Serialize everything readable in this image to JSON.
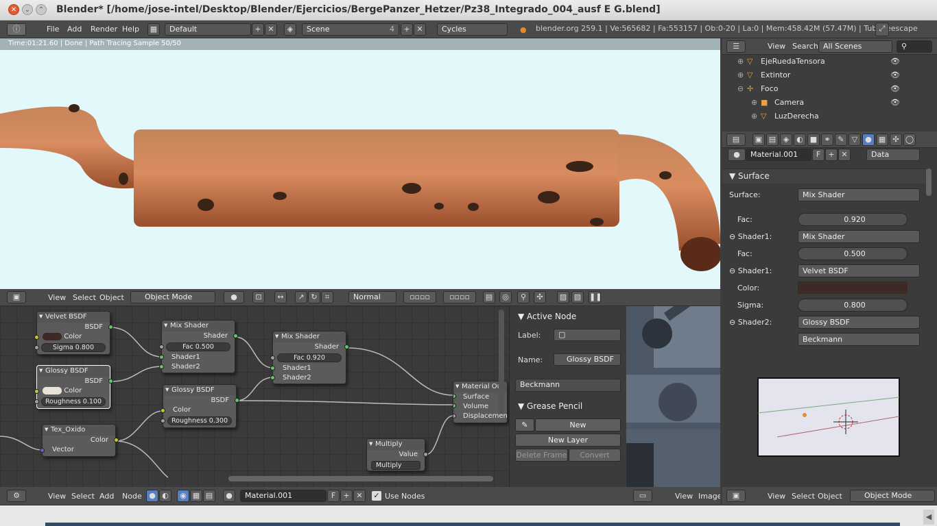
{
  "window": {
    "title": "Blender* [/home/jose-intel/Desktop/Blender/Ejercicios/BergePanzer_Hetzer/Pz38_Integrado_004_ausf E G.blend]"
  },
  "topbar": {
    "menus": [
      "File",
      "Add",
      "Render",
      "Help"
    ],
    "layout": "Default",
    "scene": "Scene",
    "scene_users": "4",
    "engine": "Cycles",
    "stats": "blender.org 259.1 | Ve:565682 | Fa:553157 | Ob:0-20 | La:0 | Mem:458.42M (57.47M) | Tubodeescape"
  },
  "render": {
    "status": "Time:01:21.60 | Done | Path Tracing Sample 50/50"
  },
  "view3d_header": {
    "menus": [
      "View",
      "Select",
      "Object"
    ],
    "mode": "Object Mode",
    "pivot": "Normal"
  },
  "node_editor": {
    "nodes": {
      "velvet": {
        "title": "Velvet BSDF",
        "out": "BSDF",
        "color_label": "Color",
        "sigma": "Sigma 0.800"
      },
      "glossy1": {
        "title": "Glossy BSDF",
        "out": "BSDF",
        "color_label": "Color",
        "roughness": "Roughness 0.100"
      },
      "mix1": {
        "title": "Mix Shader",
        "out": "Shader",
        "fac": "Fac 0.500",
        "in1": "Shader1",
        "in2": "Shader2"
      },
      "glossy2": {
        "title": "Glossy BSDF",
        "out": "BSDF",
        "color_label": "Color",
        "roughness": "Roughness 0.300"
      },
      "mix2": {
        "title": "Mix Shader",
        "out": "Shader",
        "fac": "Fac 0.920",
        "in1": "Shader1",
        "in2": "Shader2"
      },
      "matout": {
        "title": "Material Out",
        "surface": "Surface",
        "volume": "Volume",
        "displacement": "Displacement"
      },
      "tex": {
        "title": "Tex_Oxido",
        "out": "Color",
        "vector": "Vector"
      },
      "multiply": {
        "title": "Multiply",
        "out": "Value",
        "op": "Multiply"
      }
    },
    "header": {
      "menus": [
        "View",
        "Select",
        "Add",
        "Node"
      ],
      "material": "Material.001",
      "fake": "F",
      "use_nodes": "Use Nodes"
    }
  },
  "active_node": {
    "title": "Active Node",
    "label_label": "Label:",
    "name_label": "Name:",
    "name": "Glossy BSDF",
    "distribution": "Beckmann",
    "grease_title": "Grease Pencil",
    "new": "New",
    "new_layer": "New Layer",
    "delete_frame": "Delete Frame",
    "convert": "Convert"
  },
  "image_editor": {
    "menus": [
      "View",
      "Image"
    ]
  },
  "outliner": {
    "menus": [
      "View",
      "Search"
    ],
    "filter": "All Scenes",
    "items": [
      "EjeRuedaTensora",
      "Extintor",
      "Foco",
      "Camera",
      "LuzDerecha"
    ]
  },
  "properties": {
    "material": "Material.001",
    "fake": "F",
    "link": "Data",
    "section": "Surface",
    "surface_label": "Surface:",
    "surface": "Mix Shader",
    "fac_label": "Fac:",
    "fac1": "0.920",
    "shader1_label": "Shader1:",
    "shader1": "Mix Shader",
    "fac2": "0.500",
    "shader1b": "Velvet BSDF",
    "color_label": "Color:",
    "sigma_label": "Sigma:",
    "sigma": "0.800",
    "shader2_label": "Shader2:",
    "shader2": "Glossy BSDF",
    "dist": "Beckmann",
    "velvet_color": "#3d2a26"
  },
  "viewport_header": {
    "menus": [
      "View",
      "Select",
      "Object"
    ],
    "mode": "Object Mode"
  },
  "colors": {
    "node_editor_bg": "#3a3a3a",
    "render_bg": "#e2f8fb",
    "socket_shader": "#63c763",
    "socket_color": "#c7c729"
  }
}
